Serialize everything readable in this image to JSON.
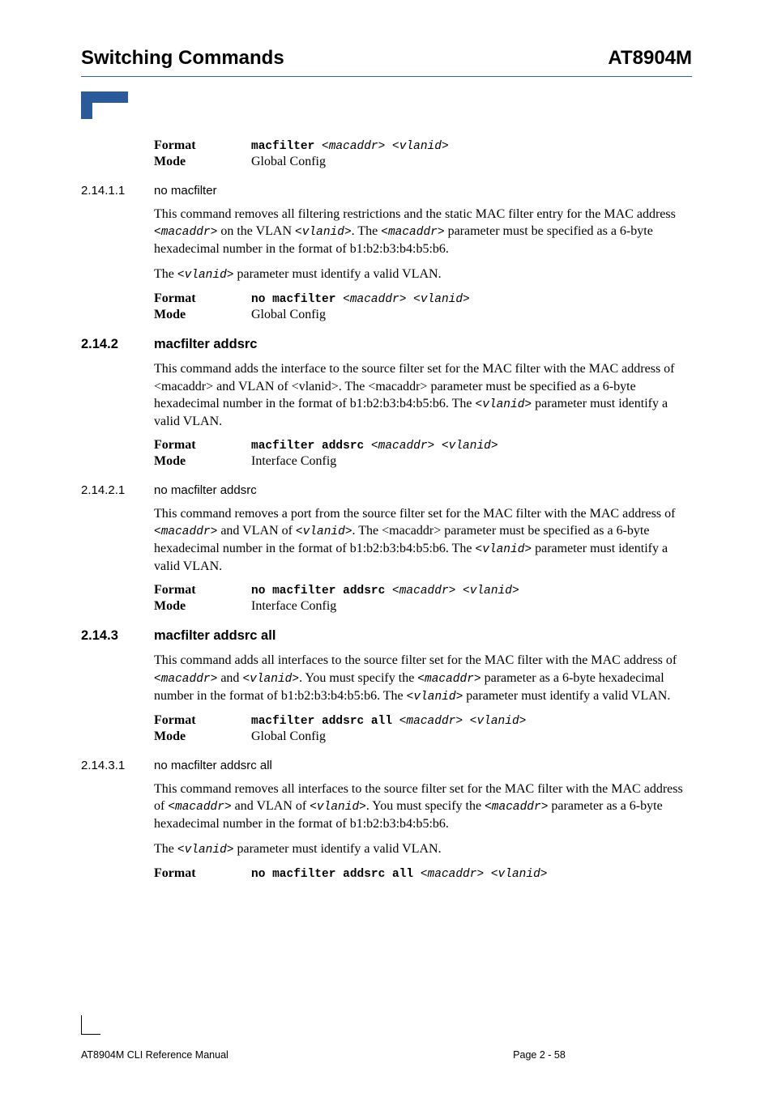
{
  "header": {
    "title": "Switching Commands",
    "product": "AT8904M"
  },
  "cmd0": {
    "fmt_label": "Format",
    "fmt_cmd": "macfilter ",
    "fmt_args": "<macaddr> <vlanid>",
    "mode_label": "Mode",
    "mode_val": "Global Config"
  },
  "s1": {
    "num": "2.14.1.1",
    "title": "no macfilter",
    "p1a": "This command removes all filtering restrictions and the static MAC filter entry for the MAC address ",
    "p1b": "<macaddr>",
    "p1c": " on the VLAN ",
    "p1d": "<vlanid>",
    "p1e": ". The ",
    "p1f": "<macaddr>",
    "p1g": " parameter must be specified as a 6-byte hexadecimal number in the format of b1:b2:b3:b4:b5:b6.",
    "p2a": "The ",
    "p2b": "<vlanid>",
    "p2c": " parameter must identify a valid VLAN.",
    "fmt_label": "Format",
    "fmt_cmd": "no macfilter ",
    "fmt_args": "<macaddr> <vlanid>",
    "mode_label": "Mode",
    "mode_val": "Global Config"
  },
  "s2": {
    "num": "2.14.2",
    "title": "macfilter addsrc",
    "p1a": "This command adds the interface to the source filter set for the MAC filter with the MAC address of <macaddr> and VLAN of <vlanid>. The <macaddr> parameter must be specified as a 6-byte hexadecimal number in the format of b1:b2:b3:b4:b5:b6. The ",
    "p1b": "<vlanid>",
    "p1c": " parameter must identify a valid VLAN.",
    "fmt_label": "Format",
    "fmt_cmd": "macfilter addsrc ",
    "fmt_args": "<macaddr> <vlanid>",
    "mode_label": "Mode",
    "mode_val": "Interface Config"
  },
  "s3": {
    "num": "2.14.2.1",
    "title": "no macfilter addsrc",
    "p1a": "This command removes a port from the source filter set for the MAC filter with the MAC address of ",
    "p1b": "<macaddr>",
    "p1c": "  and VLAN of ",
    "p1d": "<vlanid>",
    "p1e": ".   The <macaddr> parameter must be specified as a 6-byte hexadecimal number in the format of b1:b2:b3:b4:b5:b6. The ",
    "p1f": "<vlanid>",
    "p1g": " parameter must identify a valid VLAN.",
    "fmt_label": "Format",
    "fmt_cmd": "no macfilter addsrc ",
    "fmt_args": "<macaddr> <vlanid>",
    "mode_label": "Mode",
    "mode_val": "Interface Config"
  },
  "s4": {
    "num": "2.14.3",
    "title": "macfilter addsrc all",
    "p1a": "This command adds all interfaces to the source filter set for the MAC filter with the MAC address of ",
    "p1b": "<macaddr>",
    "p1c": " and ",
    "p1d": "<vlanid>",
    "p1e": ". You must specify the  ",
    "p1f": "<macaddr>",
    "p1g": " parameter as a 6-byte hexadecimal number in the format of b1:b2:b3:b4:b5:b6. The ",
    "p1h": "<vlanid>",
    "p1i": " parameter must identify a valid VLAN.",
    "fmt_label": "Format",
    "fmt_cmd": "macfilter addsrc all ",
    "fmt_args": "<macaddr> <vlanid>",
    "mode_label": "Mode",
    "mode_val": "Global Config"
  },
  "s5": {
    "num": "2.14.3.1",
    "title": "no macfilter addsrc all",
    "p1a": "This command removes all interfaces to the source filter set for the MAC filter with the MAC address of ",
    "p1b": "<macaddr>",
    "p1c": " and VLAN of ",
    "p1d": "<vlanid>",
    "p1e": ". You must specify the ",
    "p1f": "<macaddr>",
    "p1g": " parameter as a 6-byte hexadecimal number in the format of b1:b2:b3:b4:b5:b6.",
    "p2a": "The ",
    "p2b": "<vlanid>",
    "p2c": " parameter must identify a valid VLAN.",
    "fmt_label": "Format",
    "fmt_cmd": "no macfilter addsrc all ",
    "fmt_args": "<macaddr> <vlanid>"
  },
  "footer": {
    "left": "AT8904M CLI Reference Manual",
    "mid": "Page 2 - 58"
  }
}
